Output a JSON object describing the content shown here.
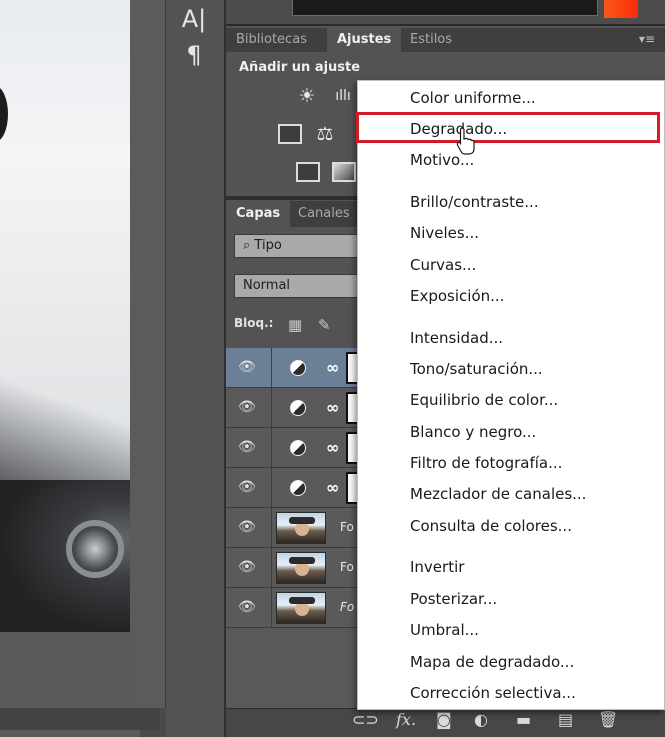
{
  "toolbar": {
    "type_tool_glyph": "A|",
    "paragraph_glyph": "¶"
  },
  "tabs_top": {
    "items": [
      "Bibliotecas",
      "Ajustes",
      "Estilos"
    ],
    "active": "Ajustes",
    "menu_glyph": "▾≡"
  },
  "adjustments": {
    "title": "Añadir un ajuste",
    "icons": [
      "brightness-icon",
      "levels-icon",
      "curves-icon",
      "balance-icon",
      "photo-filter-icon",
      "gradient-map-icon"
    ]
  },
  "tabs_layers": {
    "items": [
      "Capas",
      "Canales"
    ],
    "active": "Capas"
  },
  "layers_panel": {
    "filter_label": "Tipo",
    "search_glyph": "⌕",
    "blend_mode": "Normal",
    "lock_label": "Bloq.:",
    "layers": [
      {
        "kind": "adjustment",
        "selected": true,
        "name": ""
      },
      {
        "kind": "adjustment",
        "selected": false,
        "name": ""
      },
      {
        "kind": "adjustment",
        "selected": false,
        "name": ""
      },
      {
        "kind": "adjustment",
        "selected": false,
        "name": ""
      },
      {
        "kind": "photo",
        "selected": false,
        "name": "Fo"
      },
      {
        "kind": "photo",
        "selected": false,
        "name": "Fo"
      },
      {
        "kind": "photo",
        "selected": false,
        "name": "Fo"
      }
    ]
  },
  "footer_icons": [
    "link-icon",
    "fx-icon",
    "mask-icon",
    "adjustment-icon",
    "folder-icon",
    "new-layer-icon",
    "trash-icon"
  ],
  "footer_glyphs": {
    "fx": "fx."
  },
  "menu": {
    "groups": [
      [
        "Color uniforme...",
        "Degradado...",
        "Motivo..."
      ],
      [
        "Brillo/contraste...",
        "Niveles...",
        "Curvas...",
        "Exposición..."
      ],
      [
        "Intensidad...",
        "Tono/saturación...",
        "Equilibrio de color...",
        "Blanco y negro...",
        "Filtro de fotografía...",
        "Mezclador de canales...",
        "Consulta de colores..."
      ],
      [
        "Invertir",
        "Posterizar...",
        "Umbral...",
        "Mapa de degradado...",
        "Corrección selectiva..."
      ]
    ],
    "highlighted": "Degradado...",
    "highlight_color": "#d11a2a"
  },
  "colors": {
    "panel_bg": "#535353",
    "selected_layer": "#6b7f97",
    "swatch_red": "#ff2a0a"
  }
}
